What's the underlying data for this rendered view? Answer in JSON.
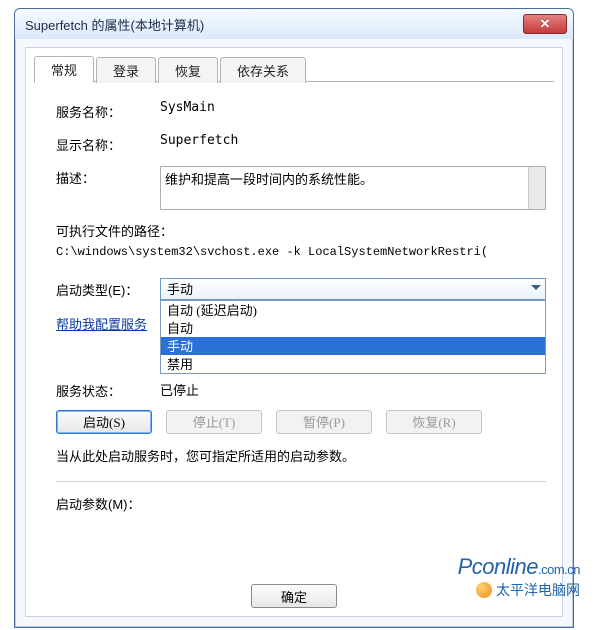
{
  "titlebar": {
    "title": "Superfetch 的属性(本地计算机)"
  },
  "tabs": [
    "常规",
    "登录",
    "恢复",
    "依存关系"
  ],
  "fields": {
    "service_name_label": "服务名称：",
    "service_name": "SysMain",
    "display_name_label": "显示名称：",
    "display_name": "Superfetch",
    "description_label": "描述：",
    "description": "维护和提高一段时间内的系统性能。",
    "path_label": "可执行文件的路径：",
    "path_value": "C:\\windows\\system32\\svchost.exe -k LocalSystemNetworkRestri(",
    "startup_type_label": "启动类型(E)：",
    "startup_type_selected": "手动",
    "startup_options": [
      "自动 (延迟启动)",
      "自动",
      "手动",
      "禁用"
    ],
    "help_link": "帮助我配置服务",
    "status_label": "服务状态：",
    "status_value": "已停止",
    "note": "当从此处启动服务时，您可指定所适用的启动参数。",
    "start_params_label": "启动参数(M)："
  },
  "buttons": {
    "start": "启动(S)",
    "stop": "停止(T)",
    "pause": "暂停(P)",
    "resume": "恢复(R)",
    "ok": "确定"
  },
  "watermark": {
    "line1_a": "Pconline",
    "line1_b": ".com.cn",
    "line2": "太平洋电脑网"
  }
}
